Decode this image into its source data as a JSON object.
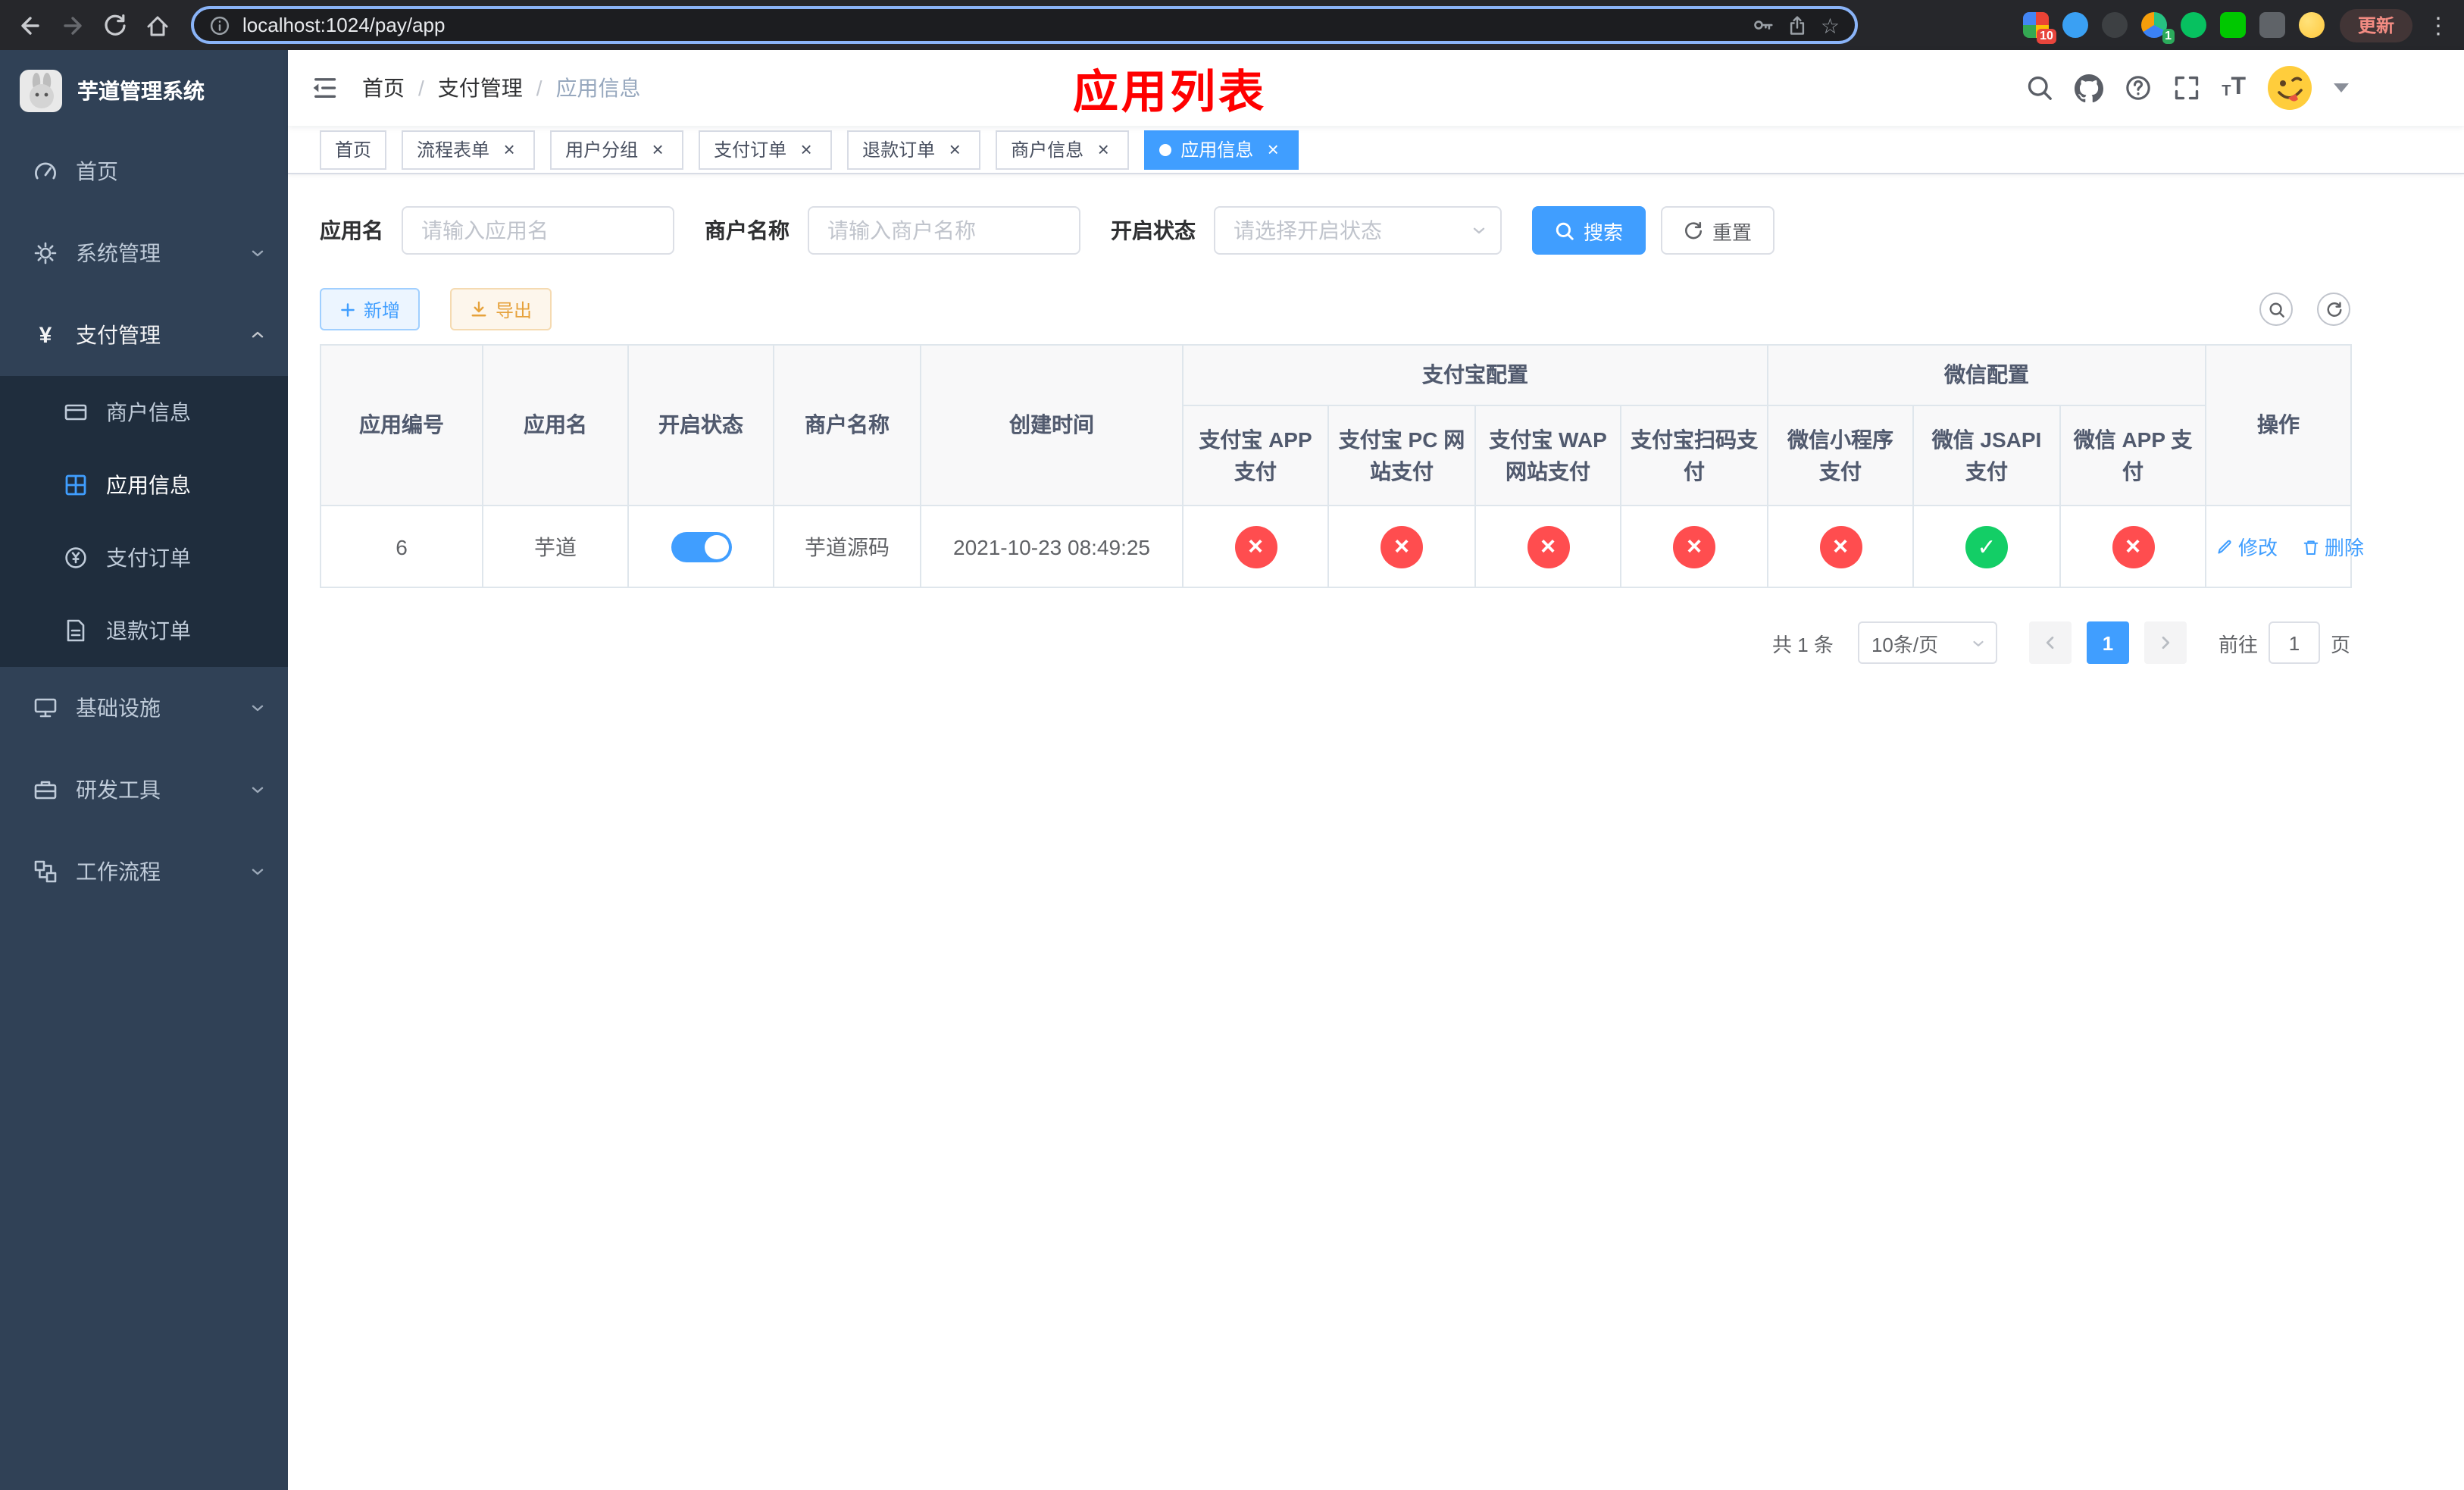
{
  "icons": {
    "star": "☆",
    "menu_dots": "⋮",
    "yen": "¥",
    "close": "×",
    "check": "✓",
    "cross": "×",
    "breadcrumb_sep": "/"
  },
  "colors": {
    "accent": "#409eff",
    "success": "#13ce66",
    "danger": "#ff4d4f",
    "warning": "#e6a23c",
    "page_title": "#ff0000",
    "sidebar_bg": "#304156",
    "sidebar_submenu_bg": "#1f2d3d",
    "active_tab_bg": "#409eff"
  },
  "browser": {
    "url": "localhost:1024/pay/app",
    "update_label": "更新",
    "extensions": [
      {
        "name": "extensions-grid",
        "badge": "10"
      },
      {
        "name": "blue-extension",
        "badge": ""
      },
      {
        "name": "dark-extension",
        "badge": ""
      },
      {
        "name": "colorful-extension",
        "badge": "1"
      },
      {
        "name": "green-circle-extension",
        "badge": ""
      },
      {
        "name": "green-chat-extension",
        "badge": ""
      },
      {
        "name": "gray-puzzle-extension",
        "badge": ""
      },
      {
        "name": "emoji-extension",
        "badge": ""
      }
    ]
  },
  "sidebar": {
    "app_title": "芋道管理系统",
    "items": [
      {
        "label": "首页"
      },
      {
        "label": "系统管理"
      },
      {
        "label": "支付管理",
        "children": [
          {
            "label": "商户信息"
          },
          {
            "label": "应用信息",
            "active": true
          },
          {
            "label": "支付订单"
          },
          {
            "label": "退款订单"
          }
        ]
      },
      {
        "label": "基础设施"
      },
      {
        "label": "研发工具"
      },
      {
        "label": "工作流程"
      }
    ]
  },
  "navbar": {
    "breadcrumb": [
      "首页",
      "支付管理",
      "应用信息"
    ],
    "page_title": "应用列表"
  },
  "tabs": [
    {
      "label": "首页",
      "closable": false,
      "active": false
    },
    {
      "label": "流程表单",
      "closable": true,
      "active": false
    },
    {
      "label": "用户分组",
      "closable": true,
      "active": false
    },
    {
      "label": "支付订单",
      "closable": true,
      "active": false
    },
    {
      "label": "退款订单",
      "closable": true,
      "active": false
    },
    {
      "label": "商户信息",
      "closable": true,
      "active": false
    },
    {
      "label": "应用信息",
      "closable": true,
      "active": true
    }
  ],
  "filters": {
    "app_name_label": "应用名",
    "app_name_placeholder": "请输入应用名",
    "merchant_label": "商户名称",
    "merchant_placeholder": "请输入商户名称",
    "status_label": "开启状态",
    "status_placeholder": "请选择开启状态",
    "search_label": "搜索",
    "reset_label": "重置"
  },
  "toolbar": {
    "add_label": "新增",
    "export_label": "导出"
  },
  "table": {
    "group_headers": [
      "支付宝配置",
      "微信配置"
    ],
    "columns": [
      "应用编号",
      "应用名",
      "开启状态",
      "商户名称",
      "创建时间",
      "支付宝 APP 支付",
      "支付宝 PC 网站支付",
      "支付宝 WAP 网站支付",
      "支付宝扫码支付",
      "微信小程序支付",
      "微信 JSAPI 支付",
      "微信 APP 支付",
      "操作"
    ],
    "op_edit": "修改",
    "op_delete": "删除",
    "rows": [
      {
        "id": "6",
        "name": "芋道",
        "enabled": true,
        "merchant": "芋道源码",
        "created_at": "2021-10-23 08:49:25",
        "configs": [
          false,
          false,
          false,
          false,
          false,
          true,
          false
        ]
      }
    ]
  },
  "pagination": {
    "total_text": "共 1 条",
    "page_size": "10条/页",
    "current_page": "1",
    "goto_label": "前往",
    "goto_value": "1",
    "page_unit": "页"
  }
}
